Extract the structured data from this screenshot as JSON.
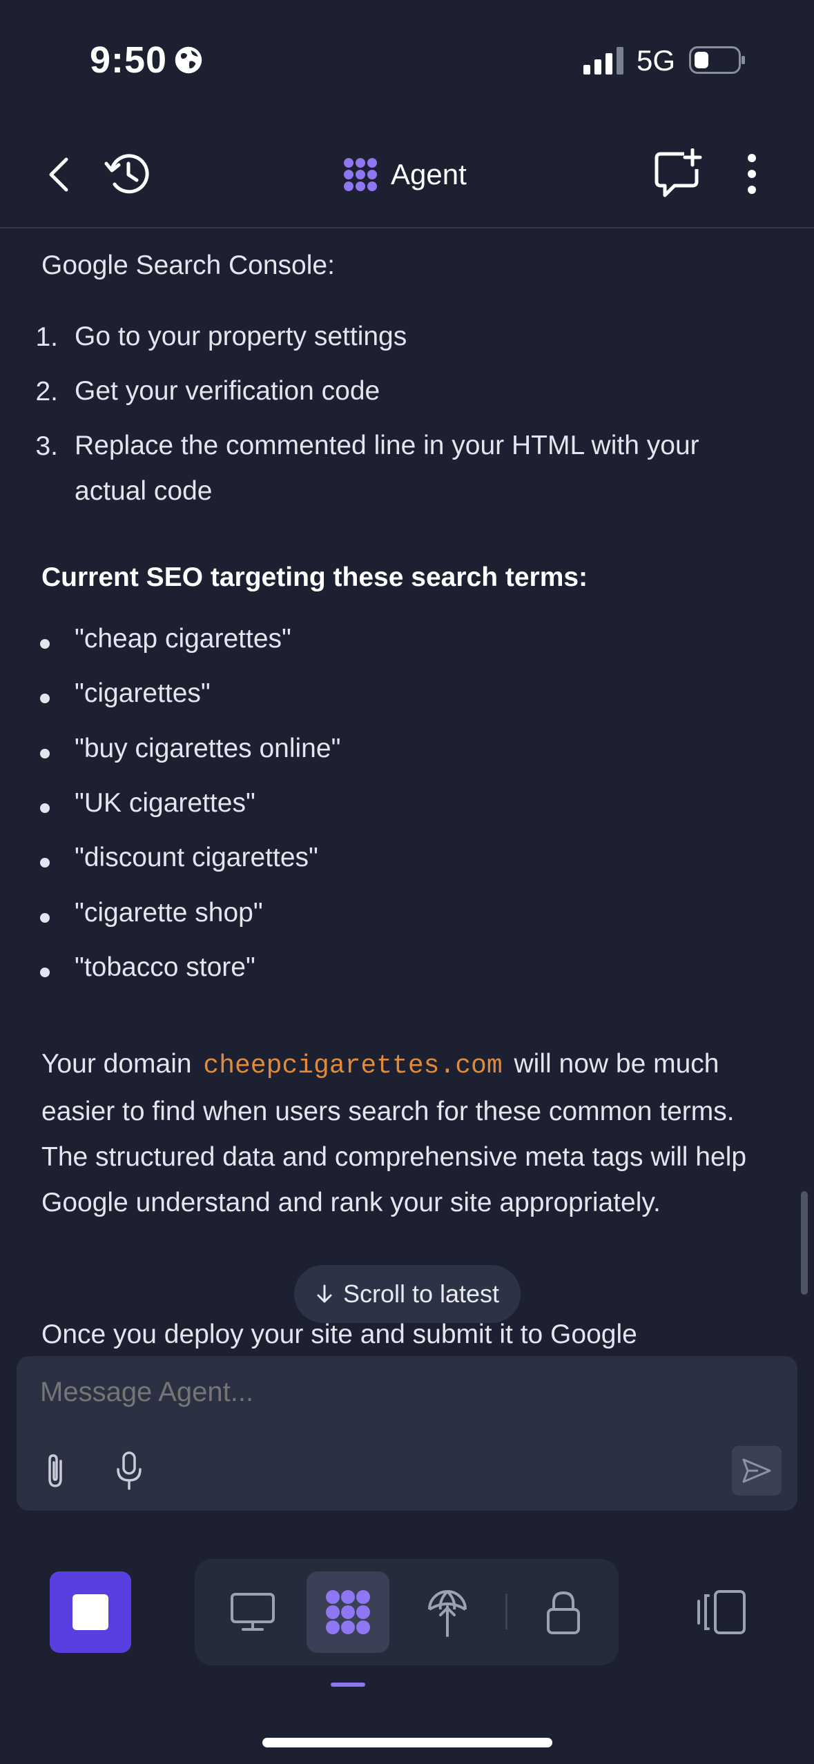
{
  "status_bar": {
    "time": "9:50",
    "network": "5G"
  },
  "header": {
    "title": "Agent"
  },
  "message": {
    "intro_tail": "Google Search Console:",
    "steps": [
      "Go to your property settings",
      "Get your verification code",
      "Replace the commented line in your HTML with your actual code"
    ],
    "step_numbers": [
      "1.",
      "2.",
      "3."
    ],
    "seo_heading": "Current SEO targeting these search terms:",
    "search_terms": [
      "\"cheap cigarettes\"",
      "\"cigarettes\"",
      "\"buy cigarettes online\"",
      "\"UK cigarettes\"",
      "\"discount cigarettes\"",
      "\"cigarette shop\"",
      "\"tobacco store\""
    ],
    "domain_prefix": "Your domain",
    "domain": "cheepcigarettes.com",
    "domain_suffix": "will now be much easier to find when users search for these common terms. The structured data and comprehensive meta tags will help Google understand and rank your site appropriately.",
    "closing_partial": "Once you deploy your site and submit it to Google"
  },
  "scroll_to_latest": {
    "label": "Scroll to latest"
  },
  "composer": {
    "placeholder": "Message Agent..."
  },
  "colors": {
    "accent": "#5a3fe0",
    "code": "#e08a3c",
    "background": "#1c2030"
  }
}
